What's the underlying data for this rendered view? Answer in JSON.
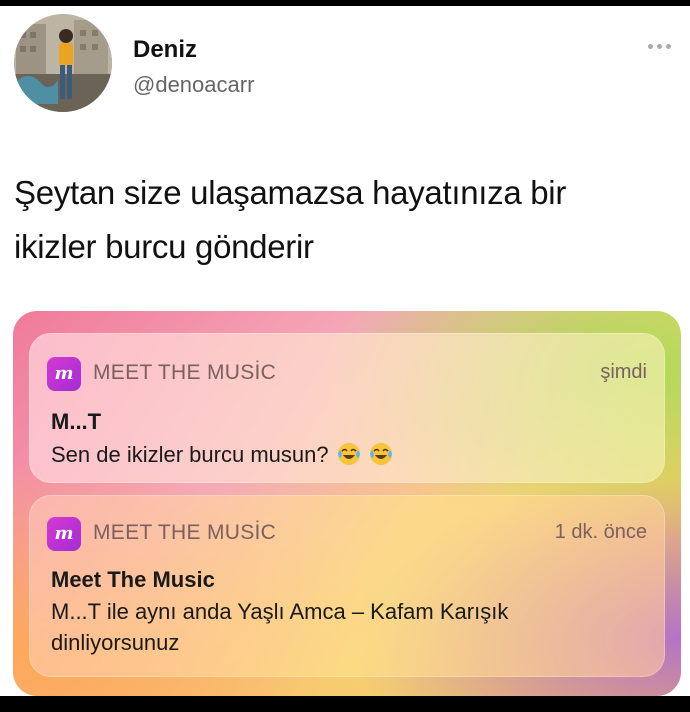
{
  "user": {
    "name": "Deniz",
    "handle": "@denoacarr"
  },
  "tweet": {
    "line1": "Şeytan size ulaşamazsa hayatınıza bir",
    "line2": "ikizler burcu gönderir"
  },
  "notifications": [
    {
      "app_icon_letter": "m",
      "app_name": "MEET THE MUSİC",
      "time": "şimdi",
      "title": "M...T",
      "body": "Sen de ikizler burcu musun?",
      "emoji": [
        "face-with-tears-of-joy-icon",
        "face-with-tears-of-joy-icon"
      ]
    },
    {
      "app_icon_letter": "m",
      "app_name": "MEET THE MUSİC",
      "time": "1 dk. önce",
      "title": "Meet The Music",
      "body_line1": "M...T ile aynı anda Yaşlı Amca – Kafam Karışık",
      "body_line2": "dinliyorsunuz"
    }
  ],
  "colors": {
    "app_icon": "#c233d3",
    "banner_pink": "#f07a9a",
    "banner_yellow": "#f2c04d"
  }
}
